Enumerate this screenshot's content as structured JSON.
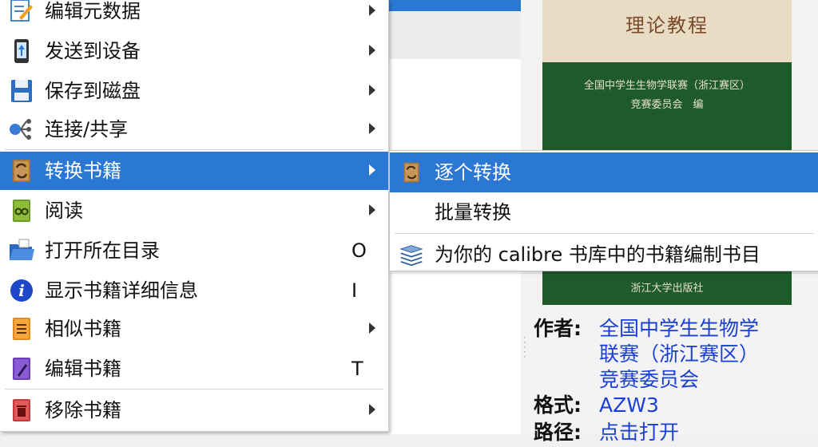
{
  "menu": {
    "items": [
      {
        "label": "编辑元数据",
        "shortcut": "",
        "submenu": true,
        "icon": "edit-metadata-icon"
      },
      {
        "label": "发送到设备",
        "shortcut": "",
        "submenu": true,
        "icon": "send-to-device-icon"
      },
      {
        "label": "保存到磁盘",
        "shortcut": "",
        "submenu": true,
        "icon": "save-to-disk-icon"
      },
      {
        "label": "连接/共享",
        "shortcut": "",
        "submenu": true,
        "icon": "connect-share-icon"
      },
      {
        "label": "转换书籍",
        "shortcut": "",
        "submenu": true,
        "icon": "convert-books-icon"
      },
      {
        "label": "阅读",
        "shortcut": "",
        "submenu": true,
        "icon": "view-icon"
      },
      {
        "label": "打开所在目录",
        "shortcut": "O",
        "submenu": false,
        "icon": "open-folder-icon"
      },
      {
        "label": "显示书籍详细信息",
        "shortcut": "I",
        "submenu": false,
        "icon": "info-icon"
      },
      {
        "label": "相似书籍",
        "shortcut": "",
        "submenu": true,
        "icon": "similar-books-icon"
      },
      {
        "label": "编辑书籍",
        "shortcut": "T",
        "submenu": false,
        "icon": "edit-book-icon"
      },
      {
        "label": "移除书籍",
        "shortcut": "",
        "submenu": true,
        "icon": "remove-books-icon"
      }
    ],
    "highlighted_index": 4
  },
  "submenu": {
    "items": [
      {
        "label": "逐个转换",
        "icon": "convert-individually-icon"
      },
      {
        "label": "批量转换",
        "icon": ""
      },
      {
        "label": "为你的 calibre 书库中的书籍编制书目",
        "icon": "catalog-icon"
      }
    ],
    "highlighted_index": 0
  },
  "cover": {
    "title": "理论教程",
    "subtitle_line1": "全国中学生生物学联赛（浙江赛区）",
    "subtitle_line2": "竞赛委员会　编",
    "publisher": "浙江大学出版社"
  },
  "details": {
    "author_label": "作者:",
    "author_lines": [
      "全国中学生生物学",
      "联赛（浙江赛区）",
      "竞赛委员会"
    ],
    "format_label": "格式:",
    "format_value": "AZW3",
    "path_label": "路径:",
    "path_value": "点击打开"
  },
  "colors": {
    "highlight": "#2b78d4",
    "link": "#1a3fd6",
    "cover_green": "#1f5a2a",
    "cover_cream": "#e9dcc4"
  }
}
